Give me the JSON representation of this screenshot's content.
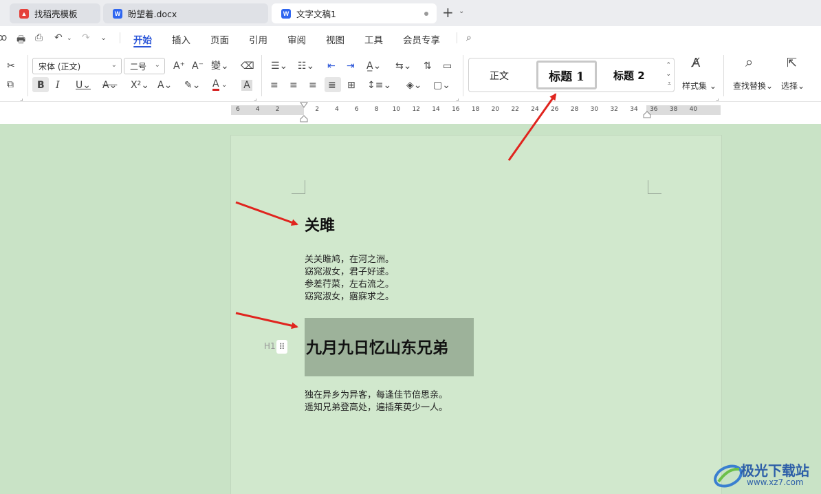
{
  "tabs": [
    {
      "label": "找稻壳模板",
      "icon": "daoke-icon",
      "icon_color": "#e5413b",
      "active": false
    },
    {
      "label": "盼望着.docx",
      "icon": "word-doc-icon",
      "icon_color": "#2f66f0",
      "active": false
    },
    {
      "label": "文字文稿1",
      "icon": "word-doc-icon",
      "icon_color": "#2f66f0",
      "active": true
    }
  ],
  "tab_icon_letter": "W",
  "menu": {
    "items": [
      "开始",
      "插入",
      "页面",
      "引用",
      "审阅",
      "视图",
      "工具",
      "会员专享"
    ],
    "active": "开始",
    "accent": "#2a55d8"
  },
  "ribbon": {
    "font_name": "宋体 (正文)",
    "font_size": "二号",
    "styles": {
      "normal": "正文",
      "heading1": "标题  1",
      "heading2": "标题  2"
    },
    "style_set_label": "样式集",
    "find_replace_label": "查找替换",
    "select_label": "选择"
  },
  "ruler": {
    "labels": [
      "6",
      "4",
      "2",
      "",
      "2",
      "4",
      "6",
      "8",
      "10",
      "12",
      "14",
      "16",
      "18",
      "20",
      "22",
      "24",
      "26",
      "28",
      "30",
      "32",
      "34",
      "36",
      "38",
      "40"
    ]
  },
  "document": {
    "heading1_text": "关雎",
    "poem1": [
      "关关雎鸠，在河之洲。",
      "窈窕淑女，君子好逑。",
      "参差荇菜，左右流之。",
      "窈窕淑女，寤寐求之。"
    ],
    "heading2_text": "九月九日忆山东兄弟",
    "heading_marker": "H1",
    "poem2": [
      "独在异乡为异客，每逢佳节倍思亲。",
      "遥知兄弟登高处，遍插茱萸少一人。"
    ]
  },
  "watermark": {
    "text": "极光下载站",
    "url": "www.xz7.com"
  },
  "annotation_color": "#e0241e"
}
